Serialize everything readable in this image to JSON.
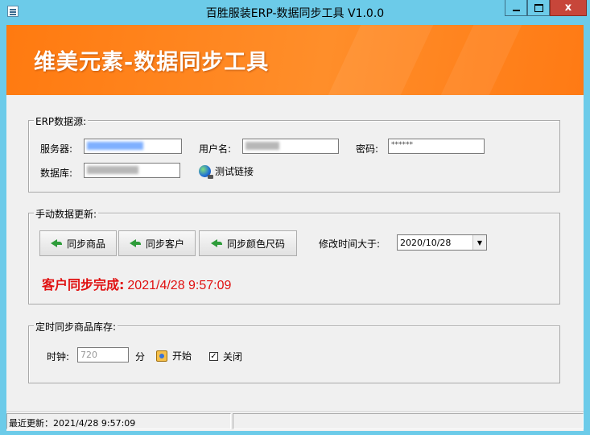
{
  "window": {
    "title": "百胜服装ERP-数据同步工具 V1.0.0",
    "close_label": "x"
  },
  "banner": {
    "title": "维美元素-数据同步工具"
  },
  "erp_source": {
    "legend": "ERP数据源:",
    "server_label": "服务器:",
    "user_label": "用户名:",
    "password_label": "密码:",
    "password_value": "******",
    "database_label": "数据库:",
    "test_link_label": "测试链接"
  },
  "manual_update": {
    "legend": "手动数据更新:",
    "sync_products_label": "同步商品",
    "sync_customers_label": "同步客户",
    "sync_color_size_label": "同步颜色尺码",
    "modified_after_label": "修改时间大于:",
    "modified_after_value": "2020/10/28",
    "status_text": "客户同步完成:",
    "status_time": "2021/4/28 9:57:09",
    "status_color": "#e01010"
  },
  "scheduled_sync": {
    "legend": "定时同步商品库存:",
    "clock_label": "时钟:",
    "interval_value": "720",
    "unit_label": "分",
    "start_label": "开始",
    "close_label": "关闭"
  },
  "statusbar": {
    "last_update": "最近更新：2021/4/28 9:57:09"
  },
  "colors": {
    "banner": "#ff8a20",
    "titlebar": "#6ccbe9"
  }
}
